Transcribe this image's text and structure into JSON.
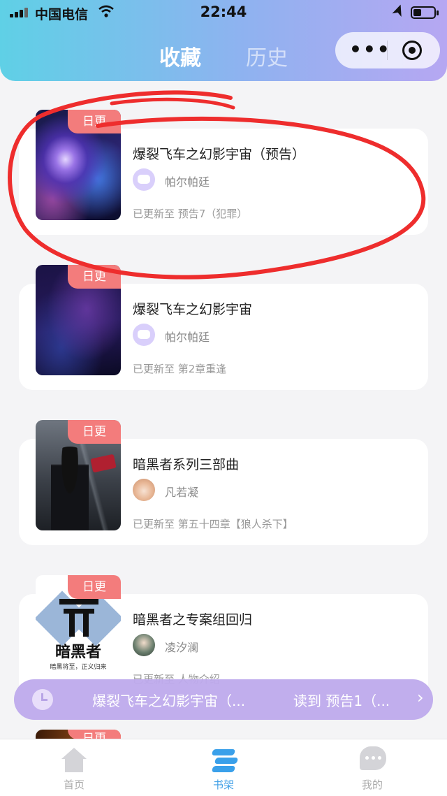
{
  "status_bar": {
    "carrier": "中国电信",
    "time": "22:44"
  },
  "header": {
    "tabs": [
      {
        "label": "收藏",
        "active": true
      },
      {
        "label": "历史",
        "active": false
      }
    ],
    "capsule": {
      "more_icon": "more-dots-icon",
      "close_icon": "target-icon"
    }
  },
  "books": [
    {
      "badge": "日更",
      "title": "爆裂飞车之幻影宇宙（预告）",
      "author": "帕尔帕廷",
      "progress": "已更新至  预告7（犯罪）",
      "cover": "galaxy-cover"
    },
    {
      "badge": "日更",
      "title": "爆裂飞车之幻影宇宙",
      "author": "帕尔帕廷",
      "progress": "已更新至  第2章重逢",
      "cover": "galaxy-cover"
    },
    {
      "badge": "日更",
      "title": "暗黑者系列三部曲",
      "author": "凡若凝",
      "progress": "已更新至  第五十四章【狼人杀下】",
      "cover": "hooded-figure-cover"
    },
    {
      "badge": "日更",
      "title": "暗黑者之专案组回归",
      "author": "凌汐澜",
      "progress": "已更新至  人物介绍",
      "cover": "anheizhe-logo-cover",
      "cover_title": "暗黑者",
      "cover_subtitle": "暗黑将至，正义归来"
    },
    {
      "badge": "日更"
    }
  ],
  "reading_bar": {
    "title": "爆裂飞车之幻影宇宙（...",
    "read_to": "读到  预告1（...",
    "arrow": "›"
  },
  "bottom_nav": [
    {
      "label": "首页",
      "icon": "home-icon",
      "active": false
    },
    {
      "label": "书架",
      "icon": "bookshelf-icon",
      "active": true
    },
    {
      "label": "我的",
      "icon": "chat-icon",
      "active": false
    }
  ],
  "colors": {
    "badge": "#f37c7c",
    "active_nav": "#3e9ee6",
    "annotation": "#ee2d2d"
  }
}
